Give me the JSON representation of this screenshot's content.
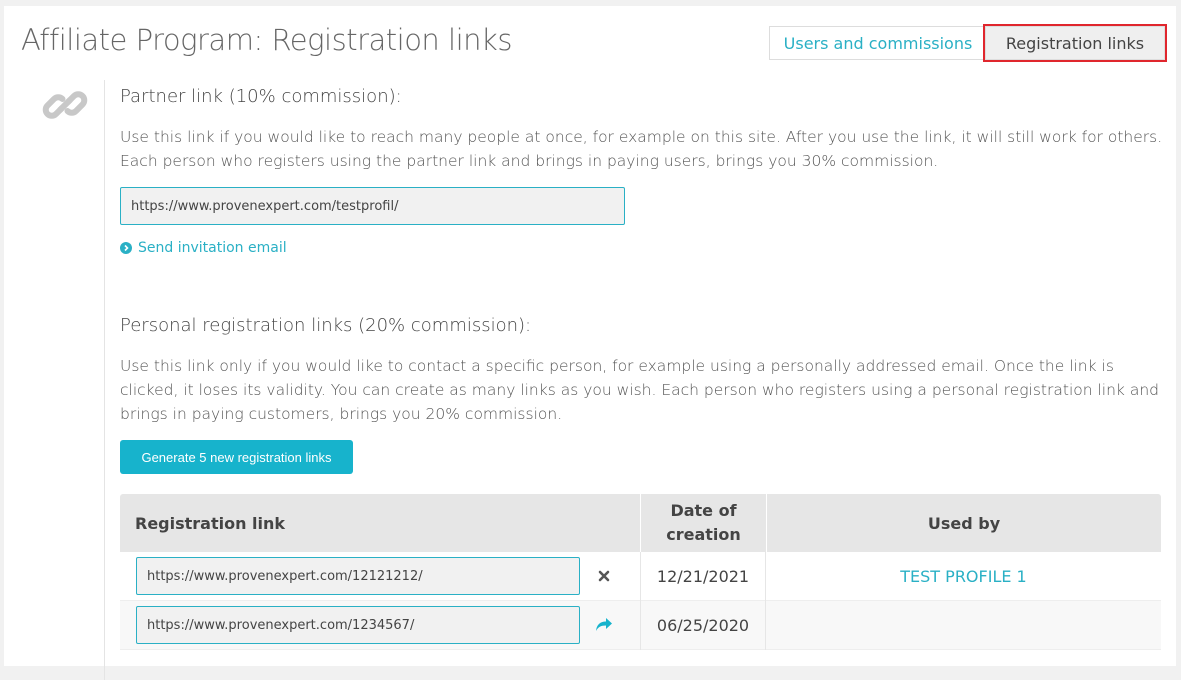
{
  "header": {
    "title": "Affiliate Program: Registration links",
    "tabs": [
      {
        "label": "Users and commissions",
        "active": false
      },
      {
        "label": "Registration links",
        "active": true
      }
    ]
  },
  "partner": {
    "heading": "Partner link (10% commission):",
    "description": "Use this link if you would like to reach many people at once, for example on this site. After you use the link, it will still work for others. Each person who registers using the partner link and brings in paying users, brings you 30% commission.",
    "link": "https://www.provenexpert.com/testprofil/",
    "send_invite_label": "Send invitation email"
  },
  "personal": {
    "heading": "Personal registration links (20% commission):",
    "description": "Use this link only if you would like to contact a specific person, for example using a personally addressed email. Once the link is clicked, it loses its validity. You can create as many links as you wish. Each person who registers using a personal registration link and brings in paying customers, brings you 20% commission.",
    "generate_button": "Generate 5 new registration links"
  },
  "table": {
    "columns": [
      "Registration link",
      "Date of creation",
      "Used by"
    ],
    "rows": [
      {
        "link": "https://www.provenexpert.com/12121212/",
        "action_icon": "close-icon",
        "date": "12/21/2021",
        "used_by": "TEST PROFILE 1"
      },
      {
        "link": "https://www.provenexpert.com/1234567/",
        "action_icon": "share-icon",
        "date": "06/25/2020",
        "used_by": ""
      }
    ]
  },
  "colors": {
    "accent": "#2ab0c5",
    "button": "#17b3cc",
    "highlight": "#e0262d"
  }
}
